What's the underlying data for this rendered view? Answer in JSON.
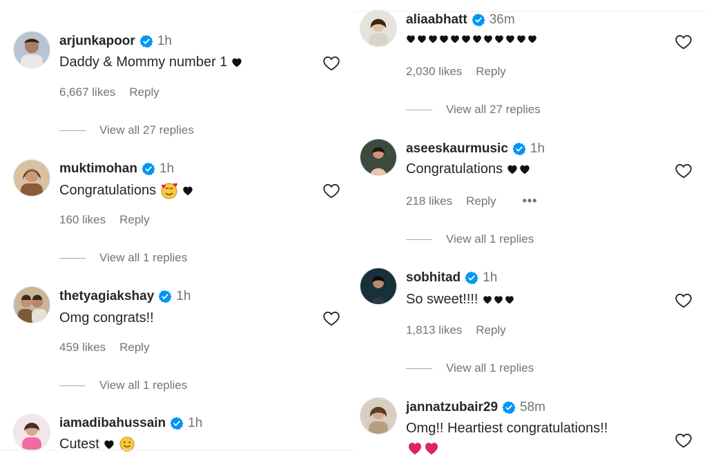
{
  "left_column": {
    "comments": [
      {
        "username": "arjunkapoor",
        "time": "1h",
        "text": "Daddy & Mommy number 1",
        "trailing": "black-heart-emoji",
        "likes": "6,667 likes",
        "reply": "Reply",
        "view_replies": "View all 27 replies"
      },
      {
        "username": "muktimohan",
        "time": "1h",
        "text": "Congratulations",
        "trailing": "smiling-face-with-hearts-emoji black-heart-emoji",
        "likes": "160 likes",
        "reply": "Reply",
        "view_replies": "View all 1 replies"
      },
      {
        "username": "thetyagiakshay",
        "time": "1h",
        "text": "Omg congrats!!",
        "likes": "459 likes",
        "reply": "Reply",
        "view_replies": "View all 1 replies"
      },
      {
        "username": "iamadibahussain",
        "time": "1h",
        "text": "Cutest",
        "trailing": "black-heart-emoji smiling-face-emoji"
      }
    ]
  },
  "right_column": {
    "comments": [
      {
        "username": "aliaabhatt",
        "time": "36m",
        "text": "",
        "trailing": "black-heart-emoji x12",
        "likes": "2,030 likes",
        "reply": "Reply",
        "view_replies": "View all 27 replies"
      },
      {
        "username": "aseeskaurmusic",
        "time": "1h",
        "text": "Congratulations",
        "trailing": "black-heart-emoji x2",
        "likes": "218 likes",
        "reply": "Reply",
        "more": "•••",
        "view_replies": "View all 1 replies"
      },
      {
        "username": "sobhitad",
        "time": "1h",
        "text": "So sweet!!!!",
        "trailing": "black-heart-emoji x3",
        "likes": "1,813 likes",
        "reply": "Reply",
        "view_replies": "View all 1 replies"
      },
      {
        "username": "jannatzubair29",
        "time": "58m",
        "text": "Omg!! Heartiest congratulations!!",
        "trailing": "red-heart-emoji x2"
      }
    ]
  },
  "colors": {
    "text": "#262626",
    "secondary": "#737373",
    "verified": "#0095f6",
    "red_heart": "#e0245e"
  }
}
